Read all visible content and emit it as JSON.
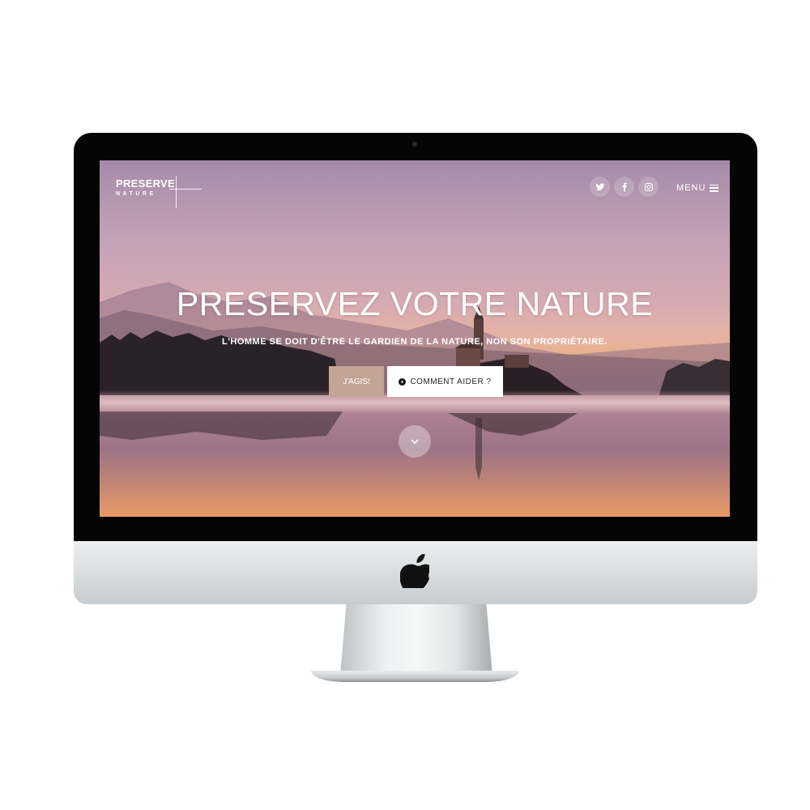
{
  "site": {
    "logo": {
      "line1": "PRESERVE",
      "line2": "NATURE"
    },
    "social": [
      {
        "name": "twitter-icon"
      },
      {
        "name": "facebook-icon"
      },
      {
        "name": "instagram-icon"
      }
    ],
    "menu": {
      "label": "MENU",
      "icon": "hamburger-icon"
    },
    "hero": {
      "title": "PRESERVEZ VOTRE NATURE",
      "subtitle": "L'HOMME SE DOIT D'ÊTRE LE GARDIEN DE LA NATURE, NON SON PROPRIÉTAIRE.",
      "primary_button": "J'AGIS!",
      "secondary_button": "COMMENT AIDER ?",
      "secondary_button_icon": "play-circle-icon",
      "scroll_icon": "chevron-down-icon"
    }
  },
  "colors": {
    "primary_button_bg": "#c2a594",
    "secondary_button_bg": "#ffffff",
    "bezel": "#050505",
    "chin": "#dcdfe1"
  },
  "device": {
    "logo_icon": "apple-logo-icon"
  }
}
